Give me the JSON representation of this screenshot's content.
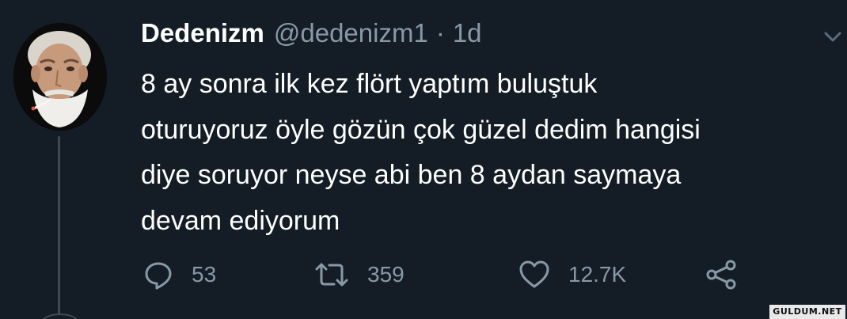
{
  "tweet": {
    "author_name": "Dedenizm",
    "handle": "@dedenizm1",
    "separator": "·",
    "time": "1d",
    "lines": [
      "8 ay sonra ilk kez flört yaptım buluştuk",
      "oturuyoruz öyle gözün çok güzel dedim hangisi",
      "diye soruyor neyse abi ben 8 aydan saymaya",
      "devam ediyorum"
    ],
    "actions": {
      "replies": "53",
      "retweets": "359",
      "likes": "12.7K"
    }
  },
  "watermark": "GULDUM.NET",
  "colors": {
    "background": "#141d26",
    "text": "#ffffff",
    "muted": "#8899a6",
    "thread_line": "#3d4a56"
  },
  "icons": [
    "reply-icon",
    "retweet-icon",
    "like-icon",
    "share-icon",
    "chevron-down-icon"
  ]
}
